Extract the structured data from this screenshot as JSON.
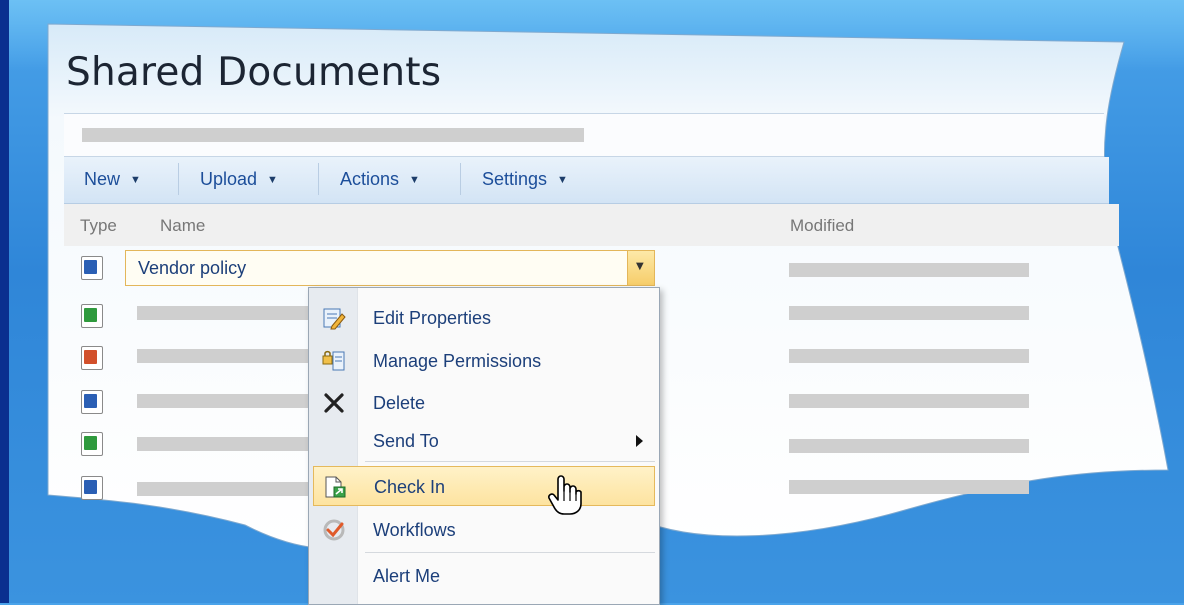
{
  "page_title": "Shared Documents",
  "toolbar": {
    "new_label": "New",
    "upload_label": "Upload",
    "actions_label": "Actions",
    "settings_label": "Settings"
  },
  "columns": {
    "type": "Type",
    "name": "Name",
    "modified": "Modified"
  },
  "selected_item": {
    "name": "Vendor policy"
  },
  "rows": [
    {
      "icon": "word-doc-icon"
    },
    {
      "icon": "excel-doc-icon"
    },
    {
      "icon": "powerpoint-doc-icon"
    },
    {
      "icon": "word-doc-icon"
    },
    {
      "icon": "excel-doc-icon"
    },
    {
      "icon": "word-doc-icon"
    }
  ],
  "context_menu": {
    "items": [
      {
        "label": "Edit Properties",
        "icon": "edit-properties-icon"
      },
      {
        "label": "Manage Permissions",
        "icon": "permissions-icon"
      },
      {
        "label": "Delete",
        "icon": "delete-x-icon"
      },
      {
        "label": "Send To",
        "icon": ""
      },
      {
        "label": "Check In",
        "icon": "check-in-icon"
      },
      {
        "label": "Workflows",
        "icon": "workflows-icon"
      },
      {
        "label": "Alert Me",
        "icon": ""
      }
    ]
  },
  "colors": {
    "background": "#3590dd",
    "link": "#1c4e9a",
    "highlight": "#fde3a0"
  }
}
